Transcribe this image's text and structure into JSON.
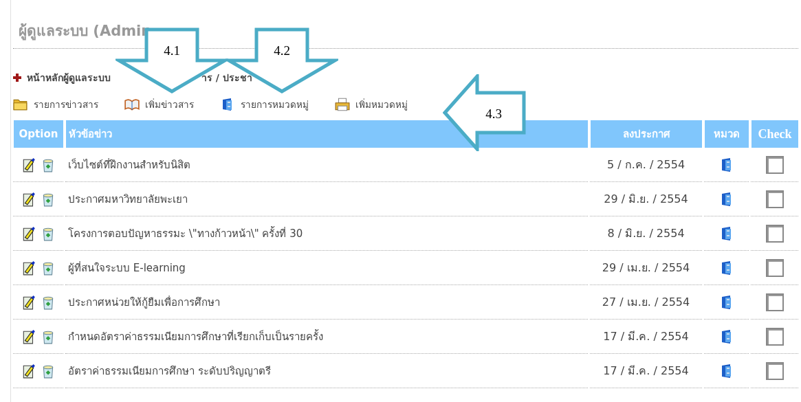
{
  "page_title": "ผู้ดูแลระบบ (Admin",
  "breadcrumb": [
    "หน้าหลักผู้ดูแลระบบ",
    "าร / ประชา"
  ],
  "toolbar": [
    {
      "label": "รายการข่าวสาร",
      "kind": "folder"
    },
    {
      "label": "เพิ่มข่าวสาร",
      "kind": "book"
    },
    {
      "label": "รายการหมวดหมู่",
      "kind": "cabinet"
    },
    {
      "label": "เพิ่มหมวดหมู่",
      "kind": "printer"
    }
  ],
  "table": {
    "columns": [
      "Option",
      "หัวข้อข่าว",
      "ลงประกาศ",
      "หมวด",
      "Check"
    ],
    "rows": [
      {
        "title": "เว็บไซต์ที่ฝึกงานสำหรับนิสิต",
        "date": "5 / ก.ค. / 2554",
        "checked": false
      },
      {
        "title": "ประกาศมหาวิทยาลัยพะเยา",
        "date": "29 / มิ.ย. / 2554",
        "checked": false
      },
      {
        "title": "โครงการตอบปัญหาธรรมะ \\\"ทางก้าวหน้า\\\" ครั้งที่ 30",
        "date": "8 / มิ.ย. / 2554",
        "checked": false
      },
      {
        "title": "ผู้ที่สนใจระบบ E-learning",
        "date": "29 / เม.ย. / 2554",
        "checked": false
      },
      {
        "title": "ประกาศหน่วยให้กู้ยืมเพื่อการศึกษา",
        "date": "27 / เม.ย. / 2554",
        "checked": false
      },
      {
        "title": "กำหนดอัตราค่าธรรมเนียมการศึกษาที่เรียกเก็บเป็นรายครั้ง",
        "date": "17 / มี.ค. / 2554",
        "checked": false
      },
      {
        "title": "อัตราค่าธรรมเนียมการศึกษา ระดับปริญญาตรี",
        "date": "17 / มี.ค. / 2554",
        "checked": false
      }
    ]
  },
  "callouts": [
    {
      "label": "4.1",
      "kind": "down"
    },
    {
      "label": "4.2",
      "kind": "down"
    },
    {
      "label": "4.3",
      "kind": "left"
    }
  ]
}
